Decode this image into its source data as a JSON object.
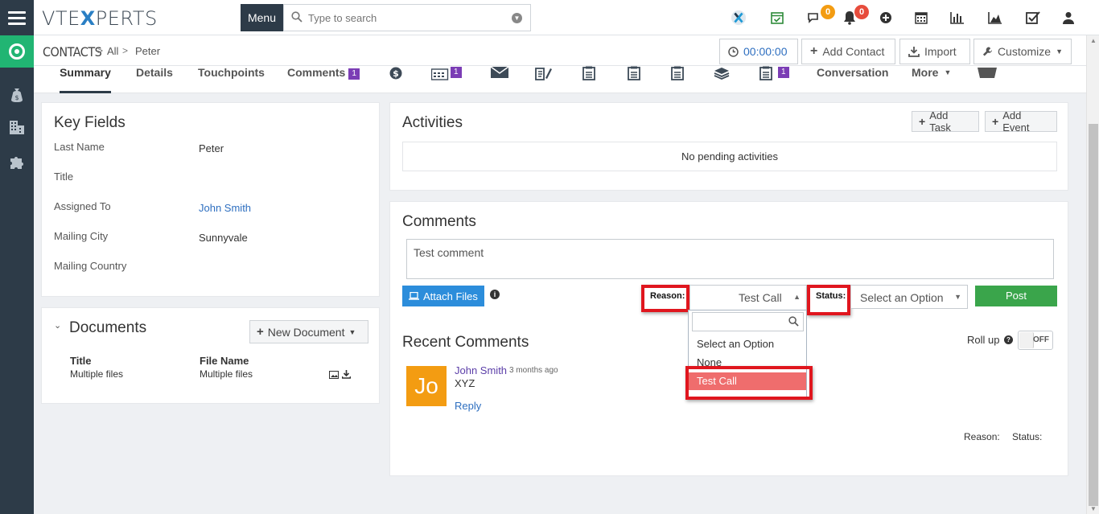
{
  "topbar": {
    "logo_left": "VTE",
    "logo_x": "X",
    "logo_right": "PERTS",
    "menu_label": "Menu",
    "search_placeholder": "Type to search",
    "chat_badge": "0",
    "notif_badge": "0",
    "icons": [
      "vtiger-x-icon",
      "calendar-check-icon",
      "chat-icon",
      "bell-icon",
      "plus-circle-icon",
      "calendar-icon",
      "bar-chart-icon",
      "area-chart-icon",
      "checkbox-icon",
      "user-icon"
    ]
  },
  "breadcrumb": {
    "module": "CONTACTS",
    "sep": ">",
    "filter": "All",
    "record": "Peter"
  },
  "header_actions": {
    "timer": "00:00:00",
    "add_contact": "Add Contact",
    "import": "Import",
    "customize": "Customize"
  },
  "tabs": {
    "summary": "Summary",
    "details": "Details",
    "touchpoints": "Touchpoints",
    "comments": "Comments",
    "comments_count": "1",
    "calendar_count": "1",
    "docs_count": "1",
    "conversation": "Conversation",
    "more": "More"
  },
  "key_fields": {
    "title": "Key Fields",
    "rows": [
      {
        "label": "Last Name",
        "value": "Peter"
      },
      {
        "label": "Title",
        "value": ""
      },
      {
        "label": "Assigned To",
        "value": "John Smith"
      },
      {
        "label": "Mailing City",
        "value": "Sunnyvale"
      },
      {
        "label": "Mailing Country",
        "value": ""
      }
    ]
  },
  "documents": {
    "title": "Documents",
    "new_button": "New Document",
    "col_title": "Title",
    "col_file": "File Name",
    "row_title": "Multiple files",
    "row_file": "Multiple files"
  },
  "activities": {
    "title": "Activities",
    "add_task": "Add Task",
    "add_event": "Add Event",
    "empty": "No pending activities"
  },
  "comments": {
    "title": "Comments",
    "input_value": "Test comment",
    "attach": "Attach Files",
    "reason_label": "Reason:",
    "reason_value": "Test Call",
    "status_label": "Status:",
    "status_value": "Select an Option",
    "post": "Post",
    "dropdown_options": [
      "Select an Option",
      "None",
      "Test Call"
    ],
    "recent_title": "Recent Comments",
    "rollup_label": "Roll up",
    "rollup_state": "OFF",
    "item": {
      "avatar": "Jo",
      "author": "John Smith",
      "time": "3 months ago",
      "text": "XYZ",
      "reply": "Reply",
      "reason": "Reason:",
      "status": "Status:"
    }
  },
  "colors": {
    "rail": "#2d3b48",
    "accent_green": "#21b573",
    "highlight_red": "#e0161e",
    "post_green": "#3aa54b",
    "attach_blue": "#2c8ddb"
  }
}
